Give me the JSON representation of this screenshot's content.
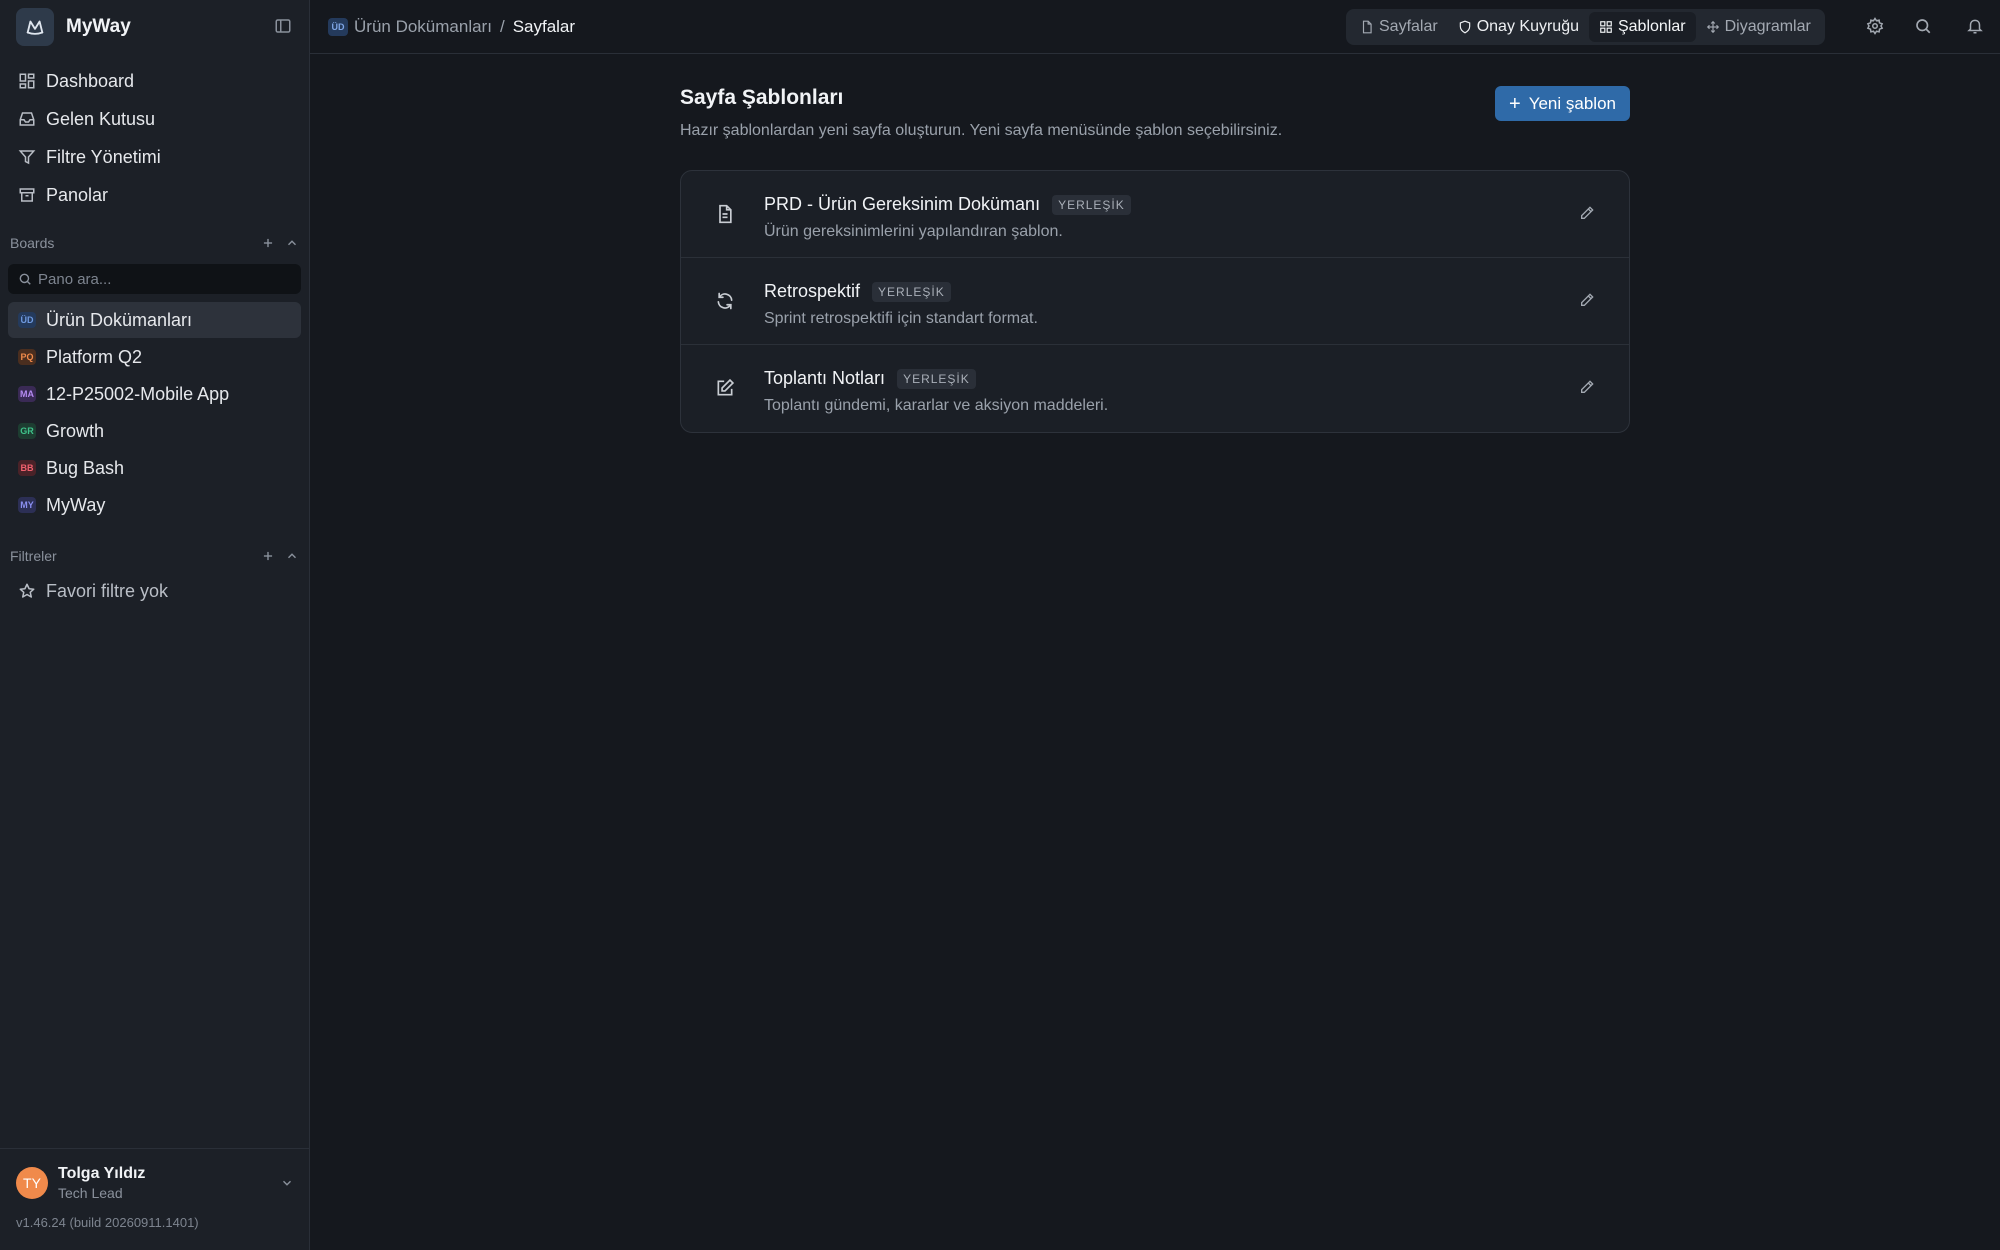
{
  "app": {
    "name": "MyWay"
  },
  "nav": [
    {
      "label": "Dashboard",
      "icon": "grid-icon"
    },
    {
      "label": "Gelen Kutusu",
      "icon": "inbox-icon"
    },
    {
      "label": "Filtre Yönetimi",
      "icon": "filter-icon"
    },
    {
      "label": "Panolar",
      "icon": "archive-icon"
    }
  ],
  "boards": {
    "title": "Boards",
    "search_placeholder": "Pano ara...",
    "items": [
      {
        "badge": "ÜD",
        "label": "Ürün Dokümanları",
        "color": "#6f9ae0",
        "bg": "#243a5c"
      },
      {
        "badge": "PQ",
        "label": "Platform Q2",
        "color": "#f08a4b",
        "bg": "#4a2e1f"
      },
      {
        "badge": "MA",
        "label": "12-P25002-Mobile App",
        "color": "#b48af0",
        "bg": "#3a2a55"
      },
      {
        "badge": "GR",
        "label": "Growth",
        "color": "#3fc28a",
        "bg": "#1d3d31"
      },
      {
        "badge": "BB",
        "label": "Bug Bash",
        "color": "#f0606e",
        "bg": "#4a2228"
      },
      {
        "badge": "MY",
        "label": "MyWay",
        "color": "#8a8ff0",
        "bg": "#2c2f55"
      }
    ]
  },
  "filters": {
    "title": "Filtreler",
    "empty": "Favori filtre yok"
  },
  "user": {
    "initials": "TY",
    "name": "Tolga Yıldız",
    "role": "Tech Lead"
  },
  "version": "v1.46.24 (build 20260911.1401)",
  "breadcrumb": {
    "badge": "ÜD",
    "parent": "Ürün Dokümanları",
    "sep": "/",
    "current": "Sayfalar"
  },
  "tabs": [
    {
      "label": "Sayfalar",
      "icon": "document-icon"
    },
    {
      "label": "Onay Kuyruğu",
      "icon": "shield-icon"
    },
    {
      "label": "Şablonlar",
      "icon": "grid-icon"
    },
    {
      "label": "Diyagramlar",
      "icon": "diagram-icon"
    }
  ],
  "page": {
    "title": "Sayfa Şablonları",
    "subtitle": "Hazır şablonlardan yeni sayfa oluşturun. Yeni sayfa menüsünde şablon seçebilirsiniz.",
    "new_button": "Yeni şablon"
  },
  "templates": [
    {
      "title": "PRD - Ürün Gereksinim Dokümanı",
      "tag": "YERLEŞİK",
      "desc": "Ürün gereksinimlerini yapılandıran şablon.",
      "icon": "document-icon"
    },
    {
      "title": "Retrospektif",
      "tag": "YERLEŞİK",
      "desc": "Sprint retrospektifi için standart format.",
      "icon": "refresh-icon"
    },
    {
      "title": "Toplantı Notları",
      "tag": "YERLEŞİK",
      "desc": "Toplantı gündemi, kararlar ve aksiyon maddeleri.",
      "icon": "edit-square-icon"
    }
  ],
  "colors": {
    "accent": "#2f6aa8",
    "bg": "#15181e",
    "sidebar": "#1c2027"
  }
}
